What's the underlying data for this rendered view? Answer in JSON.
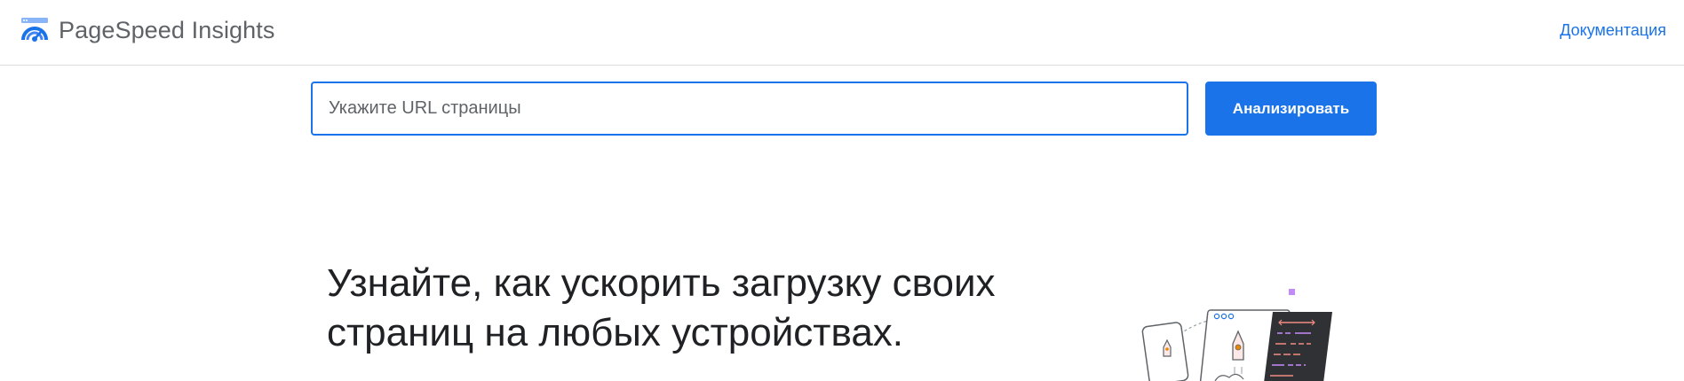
{
  "header": {
    "app_title": "PageSpeed Insights",
    "doc_link": "Документация"
  },
  "search": {
    "placeholder": "Укажите URL страницы",
    "value": "",
    "button_label": "Анализировать"
  },
  "hero": {
    "title": "Узнайте, как ускорить загрузку своих страниц на любых устройствах."
  },
  "icons": {
    "logo": "pagespeed-gauge-icon",
    "illustration": "rocket-devices-illustration"
  },
  "colors": {
    "accent": "#1a73e8",
    "title_text": "#5f6368",
    "heading_text": "#202124",
    "divider": "#dadce0"
  }
}
